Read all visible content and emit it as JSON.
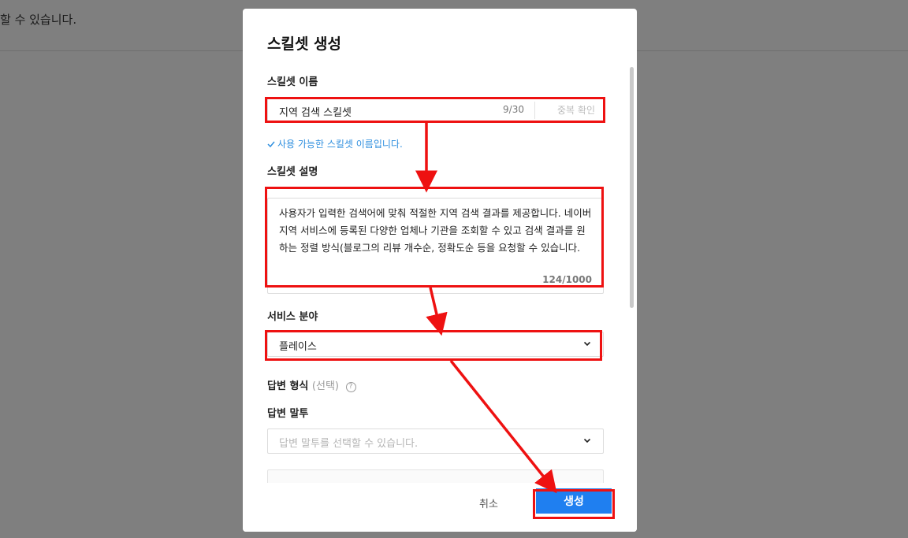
{
  "background": {
    "text": "할 수 있습니다."
  },
  "modal": {
    "title": "스킬셋 생성",
    "skillset_name": {
      "label": "스킬셋 이름",
      "value": "지역 검색 스킬셋",
      "counter": "9/30",
      "duplicate_check_label": "중복 확인",
      "success_message": "사용 가능한 스킬셋 이름입니다."
    },
    "skillset_desc": {
      "label": "스킬셋 설명",
      "value": "사용자가 입력한 검색어에 맞춰 적절한 지역 검색 결과를 제공합니다. 네이버 지역 서비스에 등록된 다양한 업체나 기관을 조회할 수 있고 검색 결과를 원하는 정렬 방식(블로그의 리뷰 개수순, 정확도순 등을 요청할 수 있습니다.",
      "counter": "124/1000"
    },
    "service_area": {
      "label": "서비스 분야",
      "selected": "플레이스"
    },
    "answer_format": {
      "label": "답변 형식",
      "optional_label": "(선택)",
      "tone_label": "답변 말투",
      "tone_placeholder": "답변 말투를 선택할 수 있습니다."
    },
    "footer": {
      "cancel_label": "취소",
      "create_label": "생성"
    }
  },
  "colors": {
    "accent": "#1f7ff0",
    "annotation": "#ee1111",
    "success": "#2f8fdf"
  }
}
